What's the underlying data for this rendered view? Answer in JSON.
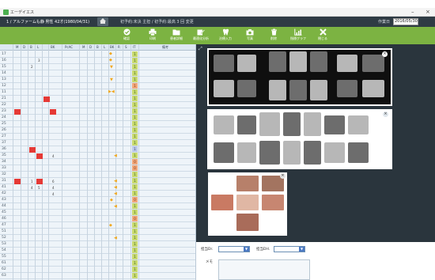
{
  "window": {
    "app_name": "エーデイエス",
    "minimize": "–",
    "close": "×"
  },
  "patient_bar": {
    "left_text": "1 / アルファームも静 男性 42才(1980/04/31)",
    "home_icon": "home-icon",
    "mid_text": "初予約:未決 主担 / 初予約:最高 3 回 変更",
    "date_label": "作業日",
    "date_value": "2016/05/30"
  },
  "toolbar": {
    "buttons": [
      {
        "label": "確認",
        "icon": "check-circle-icon"
      },
      {
        "label": "印刷",
        "icon": "printer-icon"
      },
      {
        "label": "患者詳細",
        "icon": "folder-icon"
      },
      {
        "label": "最適化分析",
        "icon": "edit-note-icon"
      },
      {
        "label": "治療入力",
        "icon": "tooth-icon"
      },
      {
        "label": "写真",
        "icon": "camera-icon"
      },
      {
        "label": "削除",
        "icon": "trash-icon"
      },
      {
        "label": "指標グラフ",
        "icon": "chart-icon"
      },
      {
        "label": "閉じる",
        "icon": "close-x-icon"
      }
    ]
  },
  "chart": {
    "columns": [
      "M",
      "D",
      "B",
      "L",
      "BK",
      "PcAC",
      "M",
      "D",
      "B",
      "L",
      "BK",
      "R",
      "S",
      "IT",
      "備考"
    ],
    "rows": [
      {
        "num": "17",
        "status": "1",
        "state": "y"
      },
      {
        "num": "16",
        "status": "1",
        "state": "y"
      },
      {
        "num": "15",
        "status": "1",
        "state": "y"
      },
      {
        "num": "14",
        "status": "1",
        "state": "y"
      },
      {
        "num": "13",
        "status": "1",
        "state": "y"
      },
      {
        "num": "12",
        "status": "1",
        "state": "o"
      },
      {
        "num": "11",
        "status": "1",
        "state": "y"
      },
      {
        "num": "21",
        "status": "1",
        "state": "y"
      },
      {
        "num": "22",
        "status": "1",
        "state": "y"
      },
      {
        "num": "23",
        "status": "1",
        "state": "y"
      },
      {
        "num": "24",
        "status": "1",
        "state": "y"
      },
      {
        "num": "25",
        "status": "1",
        "state": "y"
      },
      {
        "num": "26",
        "status": "1",
        "state": "y"
      },
      {
        "num": "27",
        "status": "1",
        "state": "y"
      },
      {
        "num": "37",
        "status": "1",
        "state": "y"
      },
      {
        "num": "36",
        "status": "1",
        "state": "b"
      },
      {
        "num": "35",
        "status": "1",
        "state": "y"
      },
      {
        "num": "34",
        "status": "0",
        "state": "o"
      },
      {
        "num": "33",
        "status": "0",
        "state": "o"
      },
      {
        "num": "32",
        "status": "1",
        "state": "y"
      },
      {
        "num": "31",
        "status": "1",
        "state": "y"
      },
      {
        "num": "41",
        "status": "1",
        "state": "y"
      },
      {
        "num": "42",
        "status": "1",
        "state": "y"
      },
      {
        "num": "43",
        "status": "0",
        "state": "o"
      },
      {
        "num": "44",
        "status": "1",
        "state": "y"
      },
      {
        "num": "45",
        "status": "1",
        "state": "y"
      },
      {
        "num": "46",
        "status": "0",
        "state": "o"
      },
      {
        "num": "47",
        "status": "1",
        "state": "y"
      },
      {
        "num": "51",
        "status": "1",
        "state": "y"
      },
      {
        "num": "52",
        "status": "1",
        "state": "y"
      },
      {
        "num": "53",
        "status": "1",
        "state": "y"
      },
      {
        "num": "54",
        "status": "1",
        "state": "y"
      },
      {
        "num": "55",
        "status": "1",
        "state": "y"
      },
      {
        "num": "61",
        "status": "1",
        "state": "y"
      },
      {
        "num": "62",
        "status": "1",
        "state": "y"
      },
      {
        "num": "63",
        "status": "1",
        "state": "y"
      }
    ],
    "cell_values": {
      "r2": "3",
      "r3": "2",
      "r17": "4",
      "r21a": "1",
      "r21b": "6",
      "r22a": "4",
      "r22b": "5",
      "r22c": "4",
      "r23": "4"
    }
  },
  "images": {
    "panoramic_close": "×",
    "dental_series_close": "×",
    "photos_close": "×"
  },
  "form": {
    "doctor_label": "担当Dr.",
    "hygienist_label": "担当DH.",
    "memo_label": "メモ",
    "doctor_value": "",
    "hygienist_value": ""
  },
  "colors": {
    "toolbar_green": "#7cb342",
    "patient_bar": "#2f3b44",
    "marker_orange": "#f0a71d",
    "red_cell": "#e53935"
  }
}
